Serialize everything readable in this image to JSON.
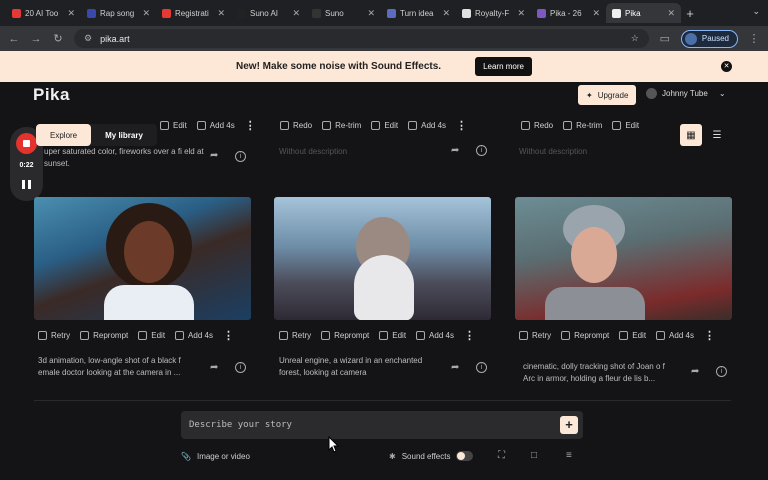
{
  "browser": {
    "tabs": [
      {
        "label": "20 AI Too",
        "color": "#e53935"
      },
      {
        "label": "Rap song",
        "color": "#3949ab"
      },
      {
        "label": "Registrati",
        "color": "#e53935"
      },
      {
        "label": "Suno AI",
        "color": "#222222"
      },
      {
        "label": "Suno",
        "color": "#333333"
      },
      {
        "label": "Turn idea",
        "color": "#5c6bc0"
      },
      {
        "label": "Royalty-F",
        "color": "#e0e0e0"
      },
      {
        "label": "Pika - 26",
        "color": "#7e57c2"
      },
      {
        "label": "Pika",
        "color": "#eeeeee"
      }
    ],
    "url": "pika.art",
    "profile_status": "Paused"
  },
  "banner": {
    "message": "New! Make some noise with Sound Effects.",
    "cta": "Learn more"
  },
  "header": {
    "logo": "Pika",
    "upgrade": "Upgrade",
    "user_name": "Johnny Tube"
  },
  "nav": {
    "explore": "Explore",
    "library": "My library"
  },
  "recorder": {
    "time": "0:22"
  },
  "top_row": [
    {
      "actions": [
        "Edit",
        "Add 4s"
      ],
      "description": "uper saturated color, fireworks over a fi eld at sunset."
    },
    {
      "actions": [
        "Redo",
        "Re-trim",
        "Edit",
        "Add 4s"
      ],
      "description": "Without description"
    },
    {
      "actions": [
        "Redo",
        "Re-trim",
        "Edit"
      ],
      "description": "Without description"
    }
  ],
  "cards": [
    {
      "actions": [
        "Retry",
        "Reprompt",
        "Edit",
        "Add 4s"
      ],
      "description": "3d animation, low-angle shot of a black f emale doctor looking at the camera in ..."
    },
    {
      "actions": [
        "Retry",
        "Reprompt",
        "Edit",
        "Add 4s"
      ],
      "description": "Unreal engine, a wizard in an enchanted forest, looking at camera"
    },
    {
      "actions": [
        "Retry",
        "Reprompt",
        "Edit",
        "Add 4s"
      ],
      "description": "cinematic, dolly tracking shot of Joan o f Arc in armor, holding a fleur de lis b..."
    }
  ],
  "composer": {
    "placeholder": "Describe your story",
    "attach": "Image or video",
    "sound_effects": "Sound effects"
  }
}
